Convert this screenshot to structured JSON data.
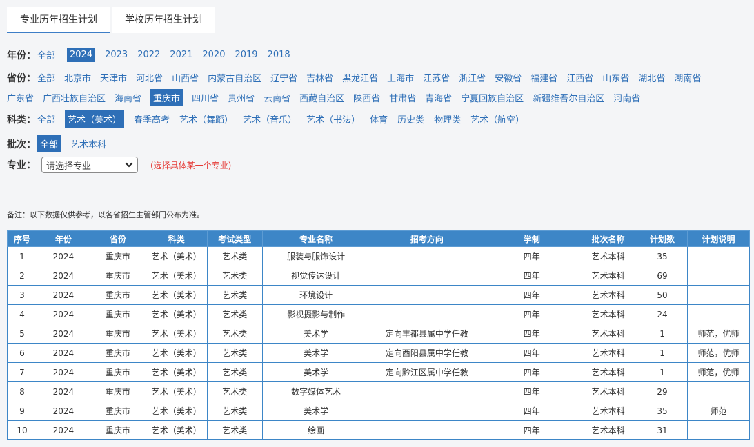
{
  "tabs": [
    {
      "label": "专业历年招生计划",
      "active": true
    },
    {
      "label": "学校历年招生计划",
      "active": false
    }
  ],
  "filters": {
    "year": {
      "label": "年份：",
      "options": [
        "全部",
        "2024",
        "2023",
        "2022",
        "2021",
        "2020",
        "2019",
        "2018"
      ],
      "selected": "2024"
    },
    "province": {
      "label": "省份：",
      "options_row1": [
        "全部",
        "北京市",
        "天津市",
        "河北省",
        "山西省",
        "内蒙古自治区",
        "辽宁省",
        "吉林省",
        "黑龙江省",
        "上海市",
        "江苏省",
        "浙江省",
        "安徽省",
        "福建省",
        "江西省",
        "山东省",
        "湖北省",
        "湖南省"
      ],
      "options_row2": [
        "广东省",
        "广西壮族自治区",
        "海南省",
        "重庆市",
        "四川省",
        "贵州省",
        "云南省",
        "西藏自治区",
        "陕西省",
        "甘肃省",
        "青海省",
        "宁夏回族自治区",
        "新疆维吾尔自治区",
        "河南省"
      ],
      "selected": "重庆市"
    },
    "category": {
      "label": "科类：",
      "options": [
        "全部",
        "艺术（美术）",
        "春季高考",
        "艺术（舞蹈）",
        "艺术（音乐）",
        "艺术（书法）",
        "体育",
        "历史类",
        "物理类",
        "艺术（航空）"
      ],
      "selected": "艺术（美术）"
    },
    "batch": {
      "label": "批次：",
      "options": [
        "全部",
        "艺术本科"
      ],
      "selected": "全部"
    },
    "major": {
      "label": "专业：",
      "select_value": "请选择专业",
      "hint": "(选择具体某一个专业)"
    }
  },
  "note": "备注：以下数据仅供参考，以各省招生主管部门公布为准。",
  "table": {
    "headers": [
      "序号",
      "年份",
      "省份",
      "科类",
      "考试类型",
      "专业名称",
      "招考方向",
      "学制",
      "批次名称",
      "计划数",
      "计划说明"
    ],
    "rows": [
      [
        "1",
        "2024",
        "重庆市",
        "艺术（美术）",
        "艺术类",
        "服装与服饰设计",
        "",
        "四年",
        "艺术本科",
        "35",
        ""
      ],
      [
        "2",
        "2024",
        "重庆市",
        "艺术（美术）",
        "艺术类",
        "视觉传达设计",
        "",
        "四年",
        "艺术本科",
        "69",
        ""
      ],
      [
        "3",
        "2024",
        "重庆市",
        "艺术（美术）",
        "艺术类",
        "环境设计",
        "",
        "四年",
        "艺术本科",
        "50",
        ""
      ],
      [
        "4",
        "2024",
        "重庆市",
        "艺术（美术）",
        "艺术类",
        "影视摄影与制作",
        "",
        "四年",
        "艺术本科",
        "24",
        ""
      ],
      [
        "5",
        "2024",
        "重庆市",
        "艺术（美术）",
        "艺术类",
        "美术学",
        "定向丰都县属中学任教",
        "四年",
        "艺术本科",
        "1",
        "师范，优师"
      ],
      [
        "6",
        "2024",
        "重庆市",
        "艺术（美术）",
        "艺术类",
        "美术学",
        "定向酉阳县属中学任教",
        "四年",
        "艺术本科",
        "1",
        "师范，优师"
      ],
      [
        "7",
        "2024",
        "重庆市",
        "艺术（美术）",
        "艺术类",
        "美术学",
        "定向黔江区属中学任教",
        "四年",
        "艺术本科",
        "1",
        "师范，优师"
      ],
      [
        "8",
        "2024",
        "重庆市",
        "艺术（美术）",
        "艺术类",
        "数字媒体艺术",
        "",
        "四年",
        "艺术本科",
        "29",
        ""
      ],
      [
        "9",
        "2024",
        "重庆市",
        "艺术（美术）",
        "艺术类",
        "美术学",
        "",
        "四年",
        "艺术本科",
        "35",
        "师范"
      ],
      [
        "10",
        "2024",
        "重庆市",
        "艺术（美术）",
        "艺术类",
        "绘画",
        "",
        "四年",
        "艺术本科",
        "31",
        ""
      ]
    ]
  },
  "colors": {
    "accent": "#2e6fb7",
    "header_bg": "#3d86c7",
    "hint": "#e53935"
  }
}
